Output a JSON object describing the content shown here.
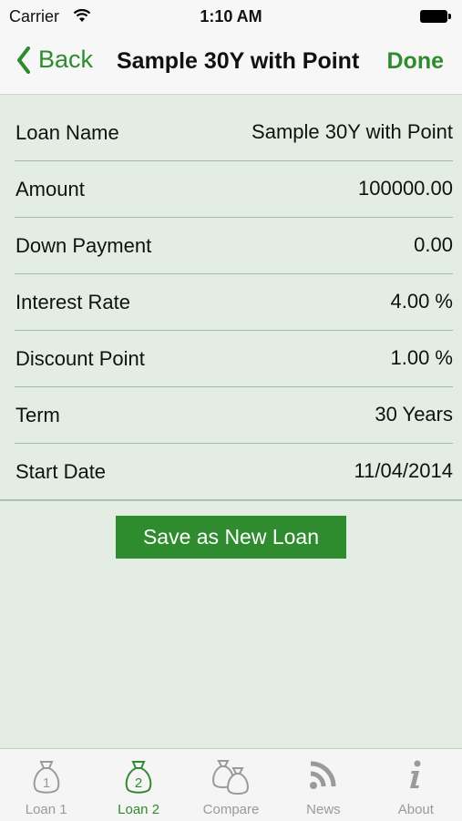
{
  "status": {
    "carrier": "Carrier",
    "time": "1:10 AM"
  },
  "nav": {
    "back_label": "Back",
    "title": "Sample 30Y with Point",
    "done_label": "Done"
  },
  "rows": [
    {
      "label": "Loan Name",
      "value": "Sample 30Y with Point"
    },
    {
      "label": "Amount",
      "value": "100000.00"
    },
    {
      "label": "Down Payment",
      "value": "0.00"
    },
    {
      "label": "Interest Rate",
      "value": "4.00 %"
    },
    {
      "label": "Discount Point",
      "value": "1.00 %"
    },
    {
      "label": "Term",
      "value": "30 Years"
    },
    {
      "label": "Start Date",
      "value": "11/04/2014"
    }
  ],
  "save_button": "Save as New Loan",
  "tabs": [
    {
      "label": "Loan 1",
      "icon": "money-bag-1-icon",
      "active": false
    },
    {
      "label": "Loan 2",
      "icon": "money-bag-2-icon",
      "active": true
    },
    {
      "label": "Compare",
      "icon": "money-bags-compare-icon",
      "active": false
    },
    {
      "label": "News",
      "icon": "rss-icon",
      "active": false
    },
    {
      "label": "About",
      "icon": "info-icon",
      "active": false
    }
  ],
  "colors": {
    "accent": "#2e8b2e",
    "background": "#e3ede3",
    "inactive_tab": "#9a9a9a"
  }
}
